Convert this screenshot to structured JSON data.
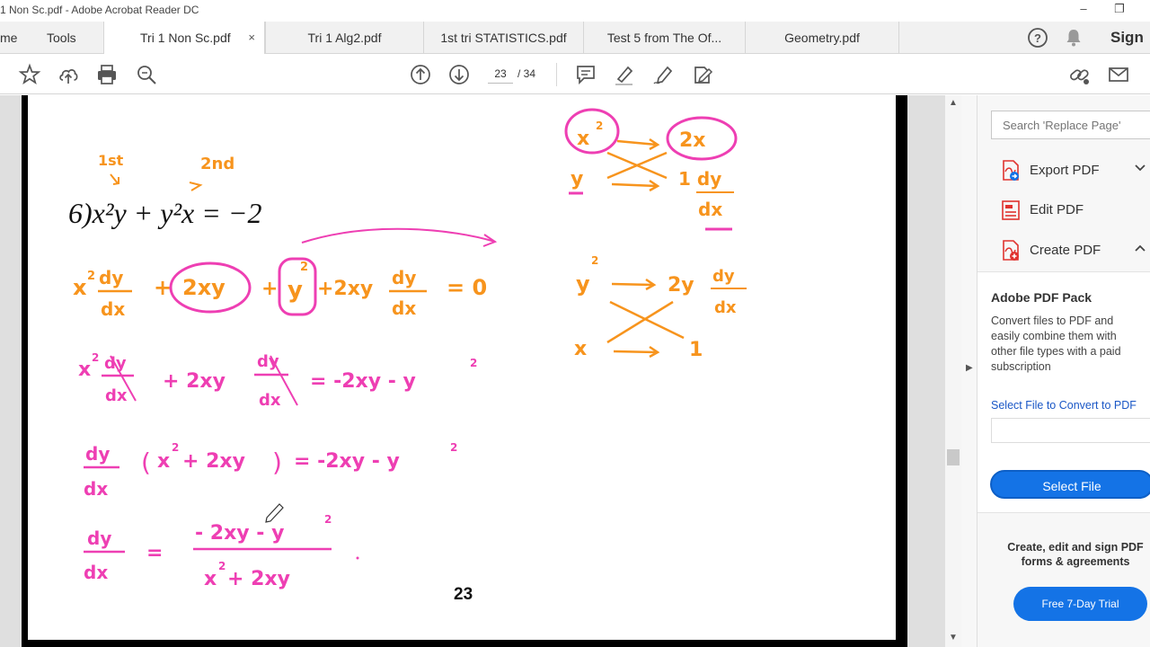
{
  "window": {
    "title": "1 Non Sc.pdf - Adobe Acrobat Reader DC"
  },
  "nav": {
    "home": "me",
    "tools": "Tools"
  },
  "tabs": [
    {
      "label": "Tri 1 Non Sc.pdf",
      "active": true
    },
    {
      "label": "Tri 1 Alg2.pdf"
    },
    {
      "label": "1st tri STATISTICS.pdf"
    },
    {
      "label": "Test 5  from The Of..."
    },
    {
      "label": "Geometry.pdf"
    }
  ],
  "tab_close": "×",
  "header": {
    "sign_in": "Sign I"
  },
  "toolbar": {
    "page_current": "23",
    "page_total": "/ 34"
  },
  "page_content": {
    "equation": "6)x²y + y²x = −2",
    "page_number": "23",
    "ink": {
      "label_1st": "1st",
      "label_2nd": "2nd",
      "line1": "x²dy/dx + (2xy) + (y²) + 2xy dy/dx = 0",
      "line2": "x²dy/dx + 2xy dy/dx = -2xy - y²",
      "line3": "dy/dx (x² + 2xy) = -2xy - y²",
      "line4": "dy/dx = (-2xy - y²) / (x² + 2xy)",
      "right1": "x² → 2x ; y → 1 dy/dx",
      "right2": "y² → 2y dy/dx ; x → 1"
    }
  },
  "right_pane": {
    "search_placeholder": "Search 'Replace Page'",
    "tools": [
      {
        "label": "Export PDF",
        "chevron": "down"
      },
      {
        "label": "Edit PDF"
      },
      {
        "label": "Create PDF",
        "chevron": "up"
      }
    ],
    "pack": {
      "title": "Adobe PDF Pack",
      "description": "Convert files to PDF and easily combine them with other file types with a paid subscription",
      "select_label": "Select File to Convert to PDF",
      "button": "Select File"
    },
    "promo": {
      "text": "Create, edit and sign PDF forms & agreements",
      "button": "Free 7-Day Trial"
    }
  },
  "colors": {
    "accent": "#1473e6",
    "ink_pink": "#ee3fb3",
    "ink_orange": "#f7941d",
    "pdf_red": "#e0332f"
  }
}
